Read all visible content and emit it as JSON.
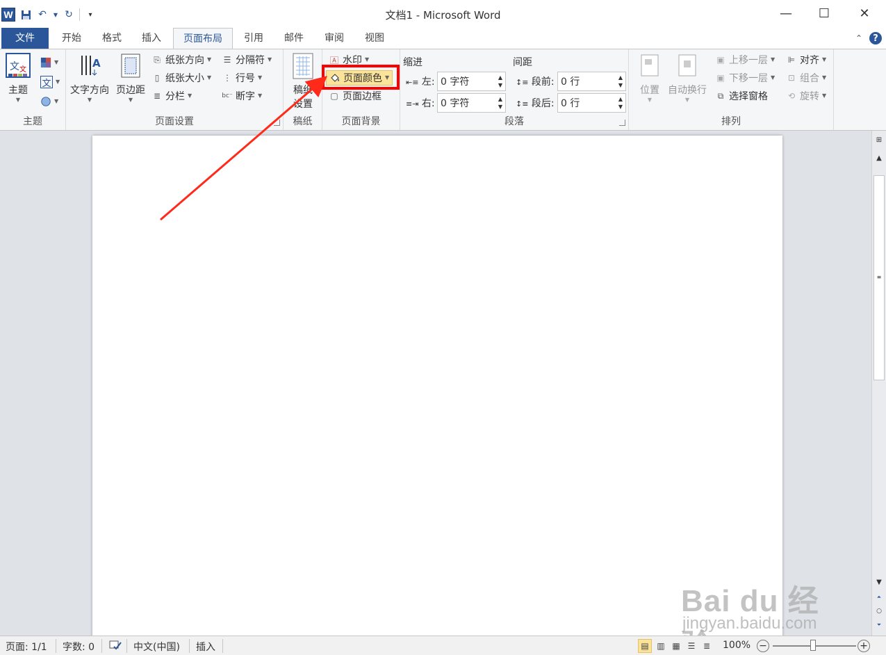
{
  "app": {
    "title": "文档1 - Microsoft Word",
    "logo_letter": "W"
  },
  "qat": {
    "items": [
      "save-icon",
      "undo-icon",
      "redo-icon",
      "customize-icon"
    ]
  },
  "window_controls": {
    "minimize": "—",
    "maximize": "☐",
    "close": "✕"
  },
  "tabs": {
    "file": "文件",
    "home": "开始",
    "format": "格式",
    "insert": "插入",
    "page_layout": "页面布局",
    "references": "引用",
    "mailings": "邮件",
    "review": "审阅",
    "view": "视图",
    "active": "页面布局",
    "collapse_symbol": "⌃",
    "help_symbol": "?"
  },
  "ribbon": {
    "themes": {
      "group_label": "主题",
      "themes_btn": "主题"
    },
    "page_setup": {
      "group_label": "页面设置",
      "text_direction": "文字方向",
      "margins": "页边距",
      "orientation": "纸张方向",
      "size": "纸张大小",
      "columns": "分栏",
      "breaks": "分隔符",
      "line_numbers": "行号",
      "hyphenation": "断字"
    },
    "manuscript": {
      "group_label": "稿纸",
      "settings_line1": "稿纸",
      "settings_line2": "设置"
    },
    "page_background": {
      "group_label": "页面背景",
      "watermark": "水印",
      "page_color": "页面颜色",
      "page_borders": "页面边框"
    },
    "paragraph": {
      "group_label": "段落",
      "indent_title": "缩进",
      "indent_left_label": "左:",
      "indent_left_value": "0 字符",
      "indent_right_label": "右:",
      "indent_right_value": "0 字符",
      "spacing_title": "间距",
      "spacing_before_label": "段前:",
      "spacing_before_value": "0 行",
      "spacing_after_label": "段后:",
      "spacing_after_value": "0 行"
    },
    "arrange": {
      "group_label": "排列",
      "position": "位置",
      "wrap_text": "自动换行",
      "bring_forward": "上移一层",
      "send_backward": "下移一层",
      "selection_pane": "选择窗格",
      "align": "对齐",
      "group": "组合",
      "rotate": "旋转"
    }
  },
  "statusbar": {
    "page": "页面: 1/1",
    "words": "字数: 0",
    "language": "中文(中国)",
    "mode": "插入",
    "zoom": "100%",
    "zoom_minus": "−",
    "zoom_plus": "+"
  },
  "watermark": {
    "brand": "Bai du 经验",
    "url": "jingyan.baidu.com"
  },
  "colors": {
    "accent": "#2b579a",
    "highlight": "#fbe39a",
    "annotation": "#ff0000",
    "canvas": "#dfe3e8"
  }
}
